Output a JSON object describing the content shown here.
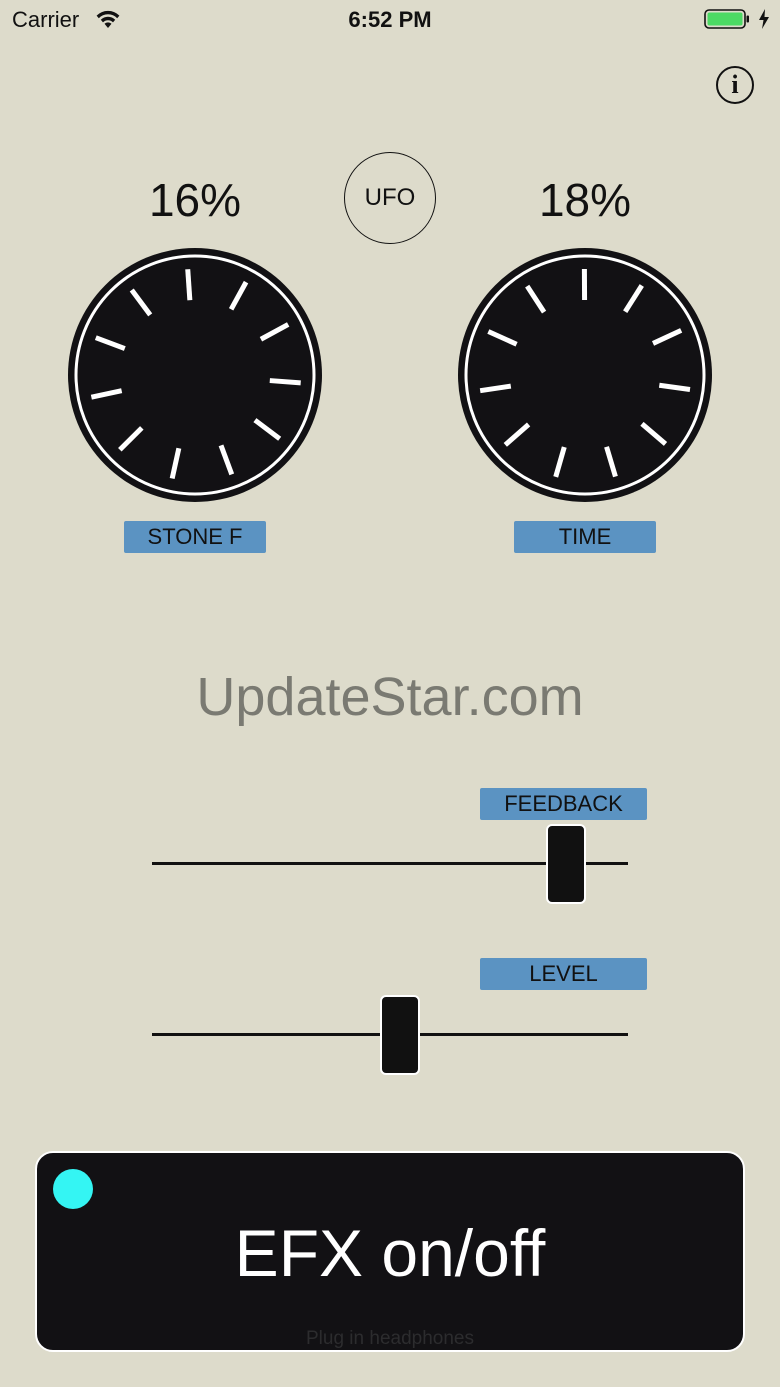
{
  "status_bar": {
    "carrier": "Carrier",
    "time": "6:52 PM",
    "wifi_icon": "wifi-icon",
    "battery_icon": "battery-icon",
    "charge_icon": "charging-bolt-icon",
    "battery_color": "#4cd964"
  },
  "info": {
    "label": "i",
    "icon": "info-icon"
  },
  "ufo_button": {
    "label": "UFO"
  },
  "knobs": [
    {
      "label": "STONE F",
      "value_text": "16%",
      "value": 0.16
    },
    {
      "label": "TIME",
      "value_text": "18%",
      "value": 0.18
    }
  ],
  "watermark": "UpdateStar.com",
  "sliders": [
    {
      "label": "FEEDBACK",
      "value": 0.87
    },
    {
      "label": "LEVEL",
      "value": 0.52
    }
  ],
  "efx_button": {
    "label": "EFX on/off",
    "hint": "Plug in headphones",
    "led_color": "#34f5f3"
  },
  "colors": {
    "background": "#dddbcb",
    "label_bg": "#5b93c2",
    "knob": "#121114"
  }
}
